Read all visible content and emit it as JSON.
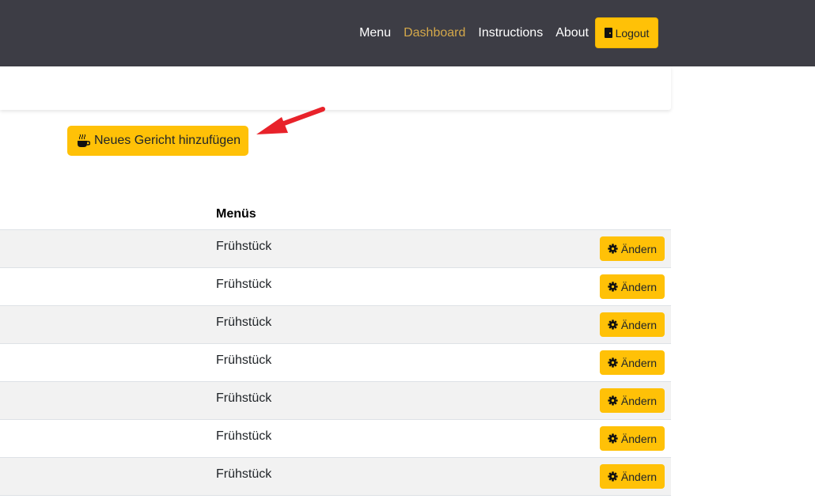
{
  "navbar": {
    "links": [
      {
        "label": "Menu"
      },
      {
        "label": "Dashboard"
      },
      {
        "label": "Instructions"
      },
      {
        "label": "About"
      }
    ],
    "active_link": "Dashboard",
    "logout_label": "Logout",
    "logout_icon": "door-icon"
  },
  "actions": {
    "add_dish_label": "Neues Gericht hinzufügen",
    "add_dish_icon": "coffee-cup-icon"
  },
  "annotation": {
    "arrow_color": "#e8222a"
  },
  "table": {
    "columns": [
      "Menüs"
    ],
    "edit_label": "Ändern",
    "edit_icon": "gear-icon",
    "rows": [
      {
        "menu": "Frühstück"
      },
      {
        "menu": "Frühstück"
      },
      {
        "menu": "Frühstück"
      },
      {
        "menu": "Frühstück"
      },
      {
        "menu": "Frühstück"
      },
      {
        "menu": "Frühstück"
      },
      {
        "menu": "Frühstück"
      }
    ]
  },
  "colors": {
    "navbar_bg": "#3d3d45",
    "accent": "#ffc107",
    "active_link": "#d4a84a",
    "row_stripe": "#f2f2f2"
  }
}
